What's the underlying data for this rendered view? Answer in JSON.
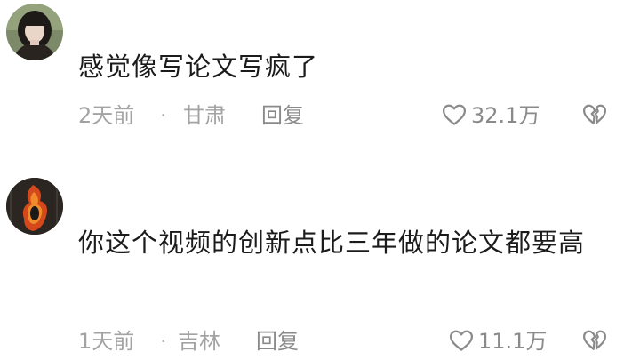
{
  "comments": [
    {
      "text": "感觉像写论文写疯了",
      "time": "2天前",
      "separator": "·",
      "location": "甘肃",
      "reply_label": "回复",
      "likes": "32.1万"
    },
    {
      "text": "你这个视频的创新点比三年做的论文都要高",
      "time": "1天前",
      "separator": "·",
      "location": "吉林",
      "reply_label": "回复",
      "likes": "11.1万"
    }
  ],
  "icons": {
    "like": "heart-outline-icon",
    "dislike": "broken-heart-icon"
  },
  "colors": {
    "text": "#1b1b1b",
    "meta": "#a3a3a3",
    "background": "#ffffff"
  }
}
